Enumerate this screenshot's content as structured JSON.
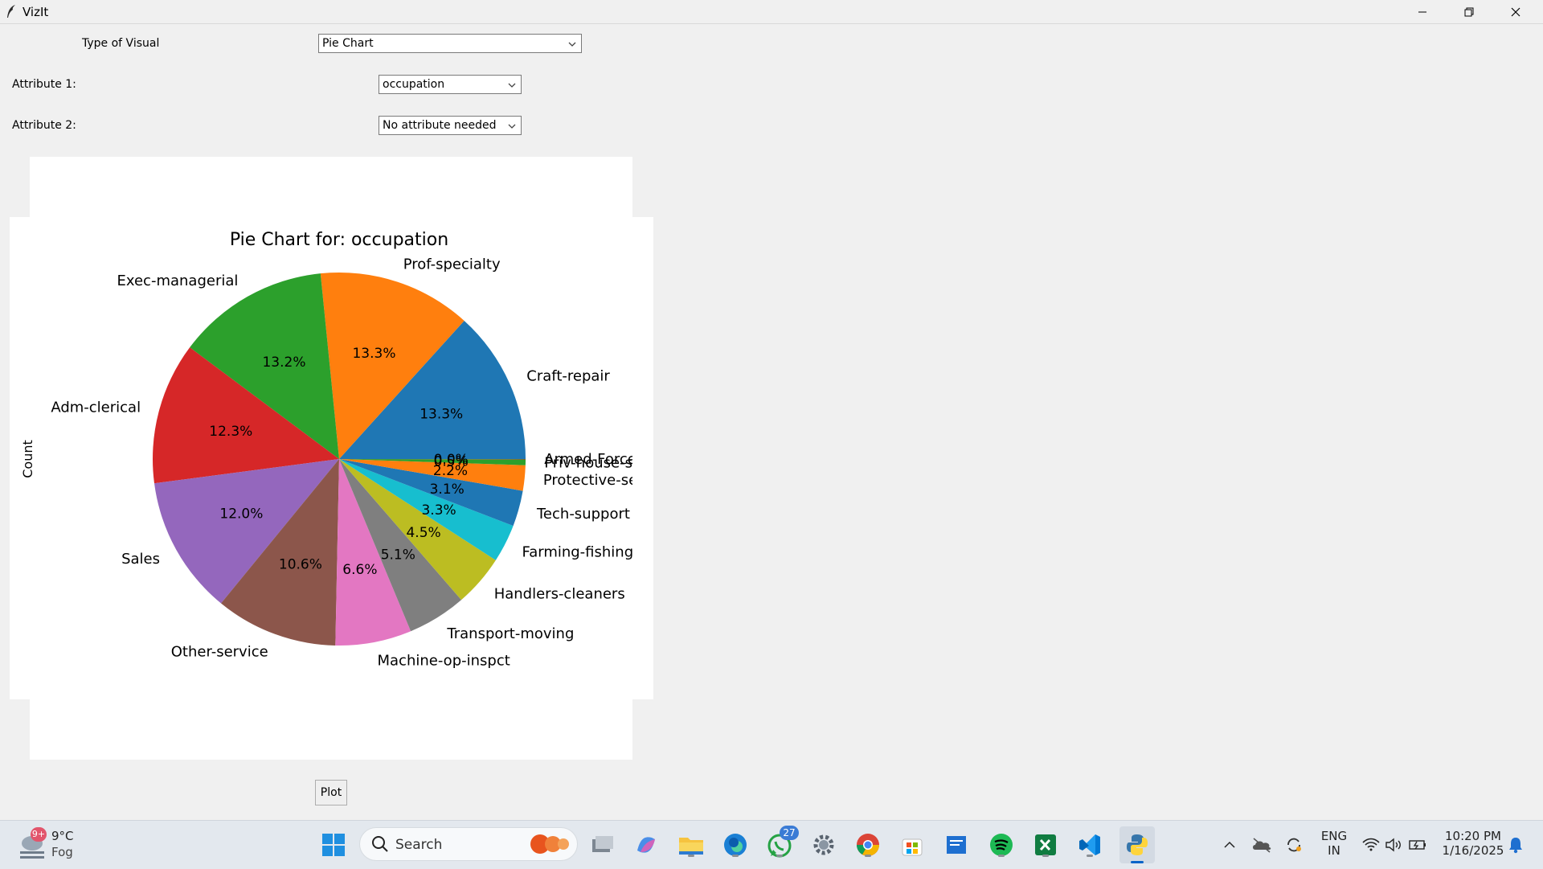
{
  "window": {
    "title": "VizIt"
  },
  "form": {
    "visual_label": "Type of Visual",
    "visual_value": "Pie Chart",
    "attr1_label": "Attribute 1:",
    "attr1_value": "occupation",
    "attr2_label": "Attribute 2:",
    "attr2_value": "No attribute needed",
    "plot_label": "Plot"
  },
  "chart_data": {
    "type": "pie",
    "title": "Pie Chart for: occupation",
    "ylabel": "Count",
    "start_angle_deg": 0,
    "direction": "counterclockwise",
    "slices": [
      {
        "label": "Craft-repair",
        "pct": "13.3%",
        "value": 13.3,
        "color": "#1f77b4"
      },
      {
        "label": "Prof-specialty",
        "pct": "13.3%",
        "value": 13.3,
        "color": "#ff7f0e"
      },
      {
        "label": "Exec-managerial",
        "pct": "13.2%",
        "value": 13.2,
        "color": "#2ca02c"
      },
      {
        "label": "Adm-clerical",
        "pct": "12.3%",
        "value": 12.3,
        "color": "#d62728"
      },
      {
        "label": "Sales",
        "pct": "12.0%",
        "value": 12.0,
        "color": "#9467bd"
      },
      {
        "label": "Other-service",
        "pct": "10.6%",
        "value": 10.6,
        "color": "#8c564b"
      },
      {
        "label": "Machine-op-inspct",
        "pct": "6.6%",
        "value": 6.6,
        "color": "#e377c2"
      },
      {
        "label": "Transport-moving",
        "pct": "5.1%",
        "value": 5.1,
        "color": "#7f7f7f"
      },
      {
        "label": "Handlers-cleaners",
        "pct": "4.5%",
        "value": 4.5,
        "color": "#bcbd22"
      },
      {
        "label": "Farming-fishing",
        "pct": "3.3%",
        "value": 3.3,
        "color": "#17becf"
      },
      {
        "label": "Tech-support",
        "pct": "3.1%",
        "value": 3.1,
        "color": "#1f77b4"
      },
      {
        "label": "Protective-se",
        "pct": "2.2%",
        "value": 2.2,
        "color": "#ff7f0e"
      },
      {
        "label": "Priv-house-se",
        "pct": "0.5%",
        "value": 0.5,
        "color": "#2ca02c"
      },
      {
        "label": "Armed-Force",
        "pct": "0.0%",
        "value": 0.03,
        "color": "#d62728"
      }
    ]
  },
  "taskbar": {
    "weather_temp": "9°C",
    "weather_cond": "Fog",
    "weather_badge": "9+",
    "search_text": "Search",
    "whatsapp_badge": "27",
    "lang_top": "ENG",
    "lang_bottom": "IN",
    "time": "10:20 PM",
    "date": "1/16/2025"
  }
}
